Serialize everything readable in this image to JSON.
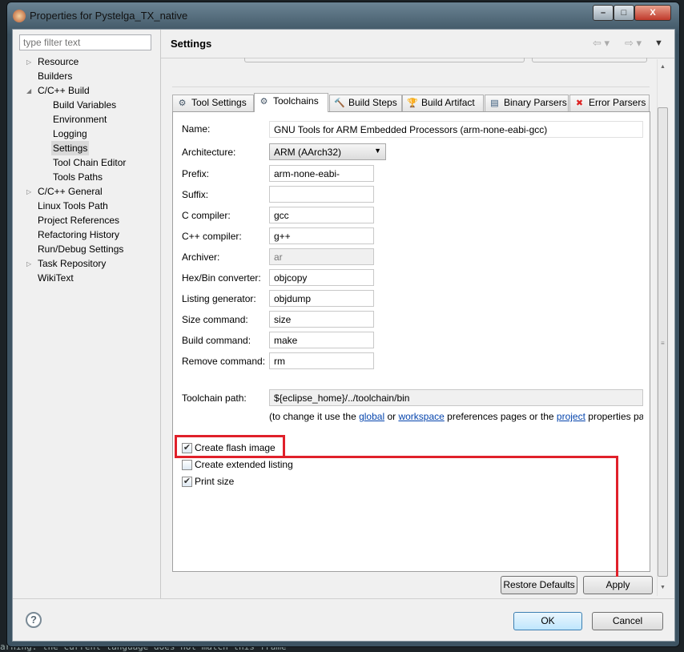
{
  "background_text": "arning: the current language does not match this frame",
  "window": {
    "title": "Properties for Pystelga_TX_native",
    "minimize": "–",
    "maximize": "□",
    "close": "X"
  },
  "filter": {
    "placeholder": "type filter text"
  },
  "tree": [
    {
      "label": "Resource",
      "level": 0,
      "expander": "collapsed"
    },
    {
      "label": "Builders",
      "level": 0,
      "expander": "none"
    },
    {
      "label": "C/C++ Build",
      "level": 0,
      "expander": "expanded"
    },
    {
      "label": "Build Variables",
      "level": 1
    },
    {
      "label": "Environment",
      "level": 1
    },
    {
      "label": "Logging",
      "level": 1
    },
    {
      "label": "Settings",
      "level": 1,
      "selected": true
    },
    {
      "label": "Tool Chain Editor",
      "level": 1
    },
    {
      "label": "Tools Paths",
      "level": 1
    },
    {
      "label": "C/C++ General",
      "level": 0,
      "expander": "collapsed"
    },
    {
      "label": "Linux Tools Path",
      "level": 0
    },
    {
      "label": "Project References",
      "level": 0
    },
    {
      "label": "Refactoring History",
      "level": 0
    },
    {
      "label": "Run/Debug Settings",
      "level": 0
    },
    {
      "label": "Task Repository",
      "level": 0,
      "expander": "collapsed"
    },
    {
      "label": "WikiText",
      "level": 0
    }
  ],
  "header": {
    "title": "Settings"
  },
  "tabs": [
    {
      "label": "Tool Settings",
      "icon": "tool-settings-icon"
    },
    {
      "label": "Toolchains",
      "icon": "toolchains-icon",
      "active": true
    },
    {
      "label": "Build Steps",
      "icon": "build-steps-icon"
    },
    {
      "label": "Build Artifact",
      "icon": "build-artifact-icon"
    },
    {
      "label": "Binary Parsers",
      "icon": "binary-parsers-icon"
    },
    {
      "label": "Error Parsers",
      "icon": "error-parsers-icon"
    }
  ],
  "form": {
    "name_label": "Name:",
    "name_value": "GNU Tools for ARM Embedded Processors (arm-none-eabi-gcc)",
    "arch_label": "Architecture:",
    "arch_value": "ARM (AArch32)",
    "fields": [
      {
        "label": "Prefix:",
        "value": "arm-none-eabi-"
      },
      {
        "label": "Suffix:",
        "value": ""
      },
      {
        "label": "C compiler:",
        "value": "gcc"
      },
      {
        "label": "C++ compiler:",
        "value": "g++"
      },
      {
        "label": "Archiver:",
        "value": "ar",
        "readonly": true
      },
      {
        "label": "Hex/Bin converter:",
        "value": "objcopy"
      },
      {
        "label": "Listing generator:",
        "value": "objdump"
      },
      {
        "label": "Size command:",
        "value": "size"
      },
      {
        "label": "Build command:",
        "value": "make"
      },
      {
        "label": "Remove command:",
        "value": "rm"
      }
    ],
    "toolchain_path_label": "Toolchain path:",
    "toolchain_path_value": "${eclipse_home}/../toolchain/bin",
    "note": {
      "p1": "(to change it use the ",
      "global": "global",
      "p2": " or ",
      "workspace": "workspace",
      "p3": " preferences pages or the ",
      "project": "project",
      "p4": " properties pag"
    },
    "checkboxes": [
      {
        "label": "Create flash image",
        "checked": true
      },
      {
        "label": "Create extended listing",
        "checked": false
      },
      {
        "label": "Print size",
        "checked": true
      }
    ]
  },
  "buttons": {
    "restore": "Restore Defaults",
    "apply": "Apply",
    "ok": "OK",
    "cancel": "Cancel",
    "help": "?"
  },
  "annotation_color": "#e0202a"
}
